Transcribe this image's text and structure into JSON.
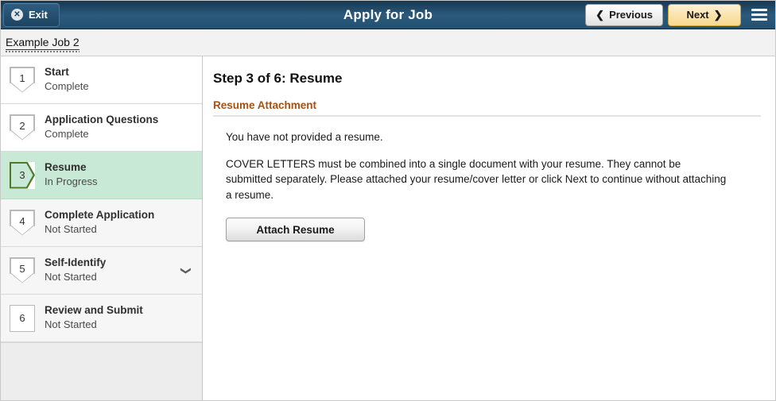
{
  "header": {
    "exit_label": "Exit",
    "exit_icon": "close-circle-icon",
    "title": "Apply for Job",
    "previous_label": "Previous",
    "previous_icon": "chevron-left-icon",
    "next_label": "Next",
    "next_icon": "chevron-right-icon",
    "menu_icon": "hamburger-menu-icon",
    "accent_blue": "#2b5a7d",
    "next_accent": "#f7d98f"
  },
  "breadcrumb": {
    "label": "Example Job 2"
  },
  "sidebar": {
    "steps": [
      {
        "number": "1",
        "title": "Start",
        "status": "Complete",
        "state": "done",
        "marker": "down",
        "expandable": false
      },
      {
        "number": "2",
        "title": "Application Questions",
        "status": "Complete",
        "state": "done",
        "marker": "down",
        "expandable": false
      },
      {
        "number": "3",
        "title": "Resume",
        "status": "In Progress",
        "state": "active",
        "marker": "right",
        "expandable": false
      },
      {
        "number": "4",
        "title": "Complete Application",
        "status": "Not Started",
        "state": "notstart",
        "marker": "down",
        "expandable": false
      },
      {
        "number": "5",
        "title": "Self-Identify",
        "status": "Not Started",
        "state": "notstart",
        "marker": "down",
        "expandable": true,
        "expand_icon": "chevron-down-icon"
      },
      {
        "number": "6",
        "title": "Review and Submit",
        "status": "Not Started",
        "state": "notstart",
        "marker": "square",
        "expandable": false
      }
    ],
    "active_color": "#c8e9d5",
    "active_marker_color": "#4e7a28"
  },
  "main": {
    "page_title": "Step 3 of 6: Resume",
    "section_heading": "Resume Attachment",
    "section_heading_color": "#a8500d",
    "paragraph_1": "You have not provided a resume.",
    "paragraph_2": "COVER LETTERS must be combined into a single document with your resume. They cannot be submitted separately. Please attached your resume/cover letter or click Next to continue without attaching a resume.",
    "attach_button_label": "Attach Resume"
  }
}
